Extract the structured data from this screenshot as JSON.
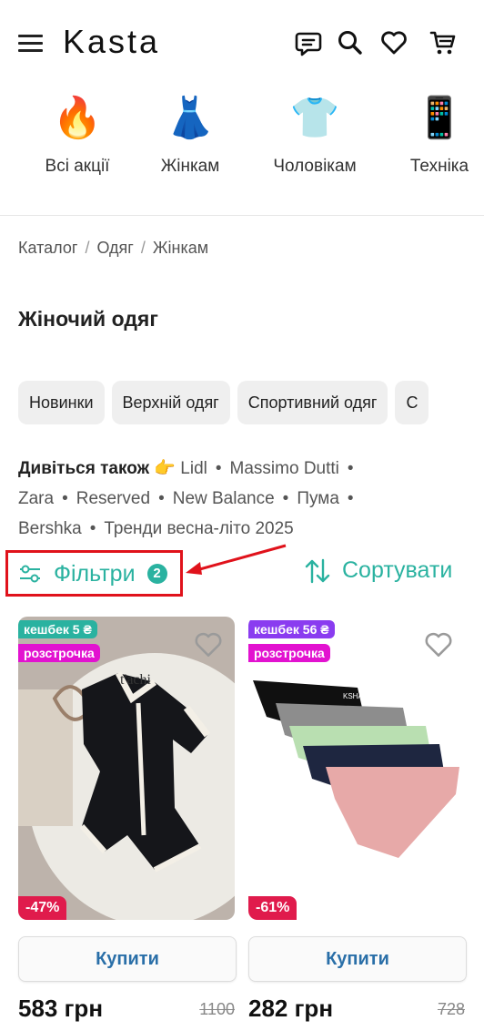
{
  "header": {
    "logo": "Kasta",
    "icons": [
      "menu-icon",
      "chat-icon",
      "search-icon",
      "heart-icon",
      "cart-icon"
    ]
  },
  "categories": [
    {
      "label": "Всі акції",
      "emoji": "🔥"
    },
    {
      "label": "Жінкам",
      "emoji": "👗"
    },
    {
      "label": "Чоловікам",
      "emoji": "👕"
    },
    {
      "label": "Техніка",
      "emoji": "📱"
    }
  ],
  "breadcrumb": [
    "Каталог",
    "Одяг",
    "Жінкам"
  ],
  "page_title": "Жіночий одяг",
  "chips": [
    "Новинки",
    "Верхній одяг",
    "Спортивний одяг",
    "С"
  ],
  "see_also": {
    "label": "Дивіться також",
    "emoji": "👉",
    "links": [
      "Lidl",
      "Massimo Dutti",
      "Zara",
      "Reserved",
      "New Balance",
      "Пума",
      "Bershka",
      "Тренди весна-літо 2025"
    ]
  },
  "filters": {
    "label": "Фільтри",
    "count": "2"
  },
  "sort": {
    "label": "Сортувати"
  },
  "accent_color": "#2ab2a0",
  "highlight_color": "#e0121b",
  "products": [
    {
      "cashback": "кешбек 5 ₴",
      "installment": "розстрочка",
      "discount": "-47%",
      "buy": "Купити",
      "price": "583 грн",
      "old_price": "1100",
      "image_text": "t'achi"
    },
    {
      "cashback": "кешбек 56 ₴",
      "installment": "розстрочка",
      "discount": "-61%",
      "buy": "Купити",
      "price": "282 грн",
      "old_price": "728",
      "image_text": "KSHA"
    }
  ]
}
